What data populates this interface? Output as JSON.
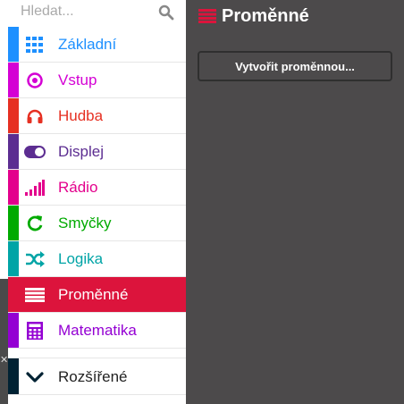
{
  "search": {
    "placeholder": "Hledat...",
    "icon": "search-icon"
  },
  "categories": [
    {
      "label": "Základní",
      "color": "#1e90ff",
      "icon": "grid-icon"
    },
    {
      "label": "Vstup",
      "color": "#d400d4",
      "icon": "radio-circle-icon"
    },
    {
      "label": "Hudba",
      "color": "#e63022",
      "icon": "headphones-icon"
    },
    {
      "label": "Displej",
      "color": "#5c2d91",
      "icon": "toggle-icon"
    },
    {
      "label": "Rádio",
      "color": "#e3008c",
      "icon": "signal-bars-icon"
    },
    {
      "label": "Smyčky",
      "color": "#00aa00",
      "icon": "refresh-icon"
    },
    {
      "label": "Logika",
      "color": "#00a4a6",
      "icon": "shuffle-icon"
    },
    {
      "label": "Proměnné",
      "color": "#dc143c",
      "icon": "list-icon",
      "selected": true
    },
    {
      "label": "Matematika",
      "color": "#9400d3",
      "icon": "calculator-icon"
    },
    {
      "label": "Rozšířené",
      "color": "#002233",
      "icon": "chevron-down-icon"
    }
  ],
  "workspace": {
    "title": "Proměnné",
    "title_icon": "list-icon",
    "create_button": "Vytvořit proměnnou..."
  }
}
